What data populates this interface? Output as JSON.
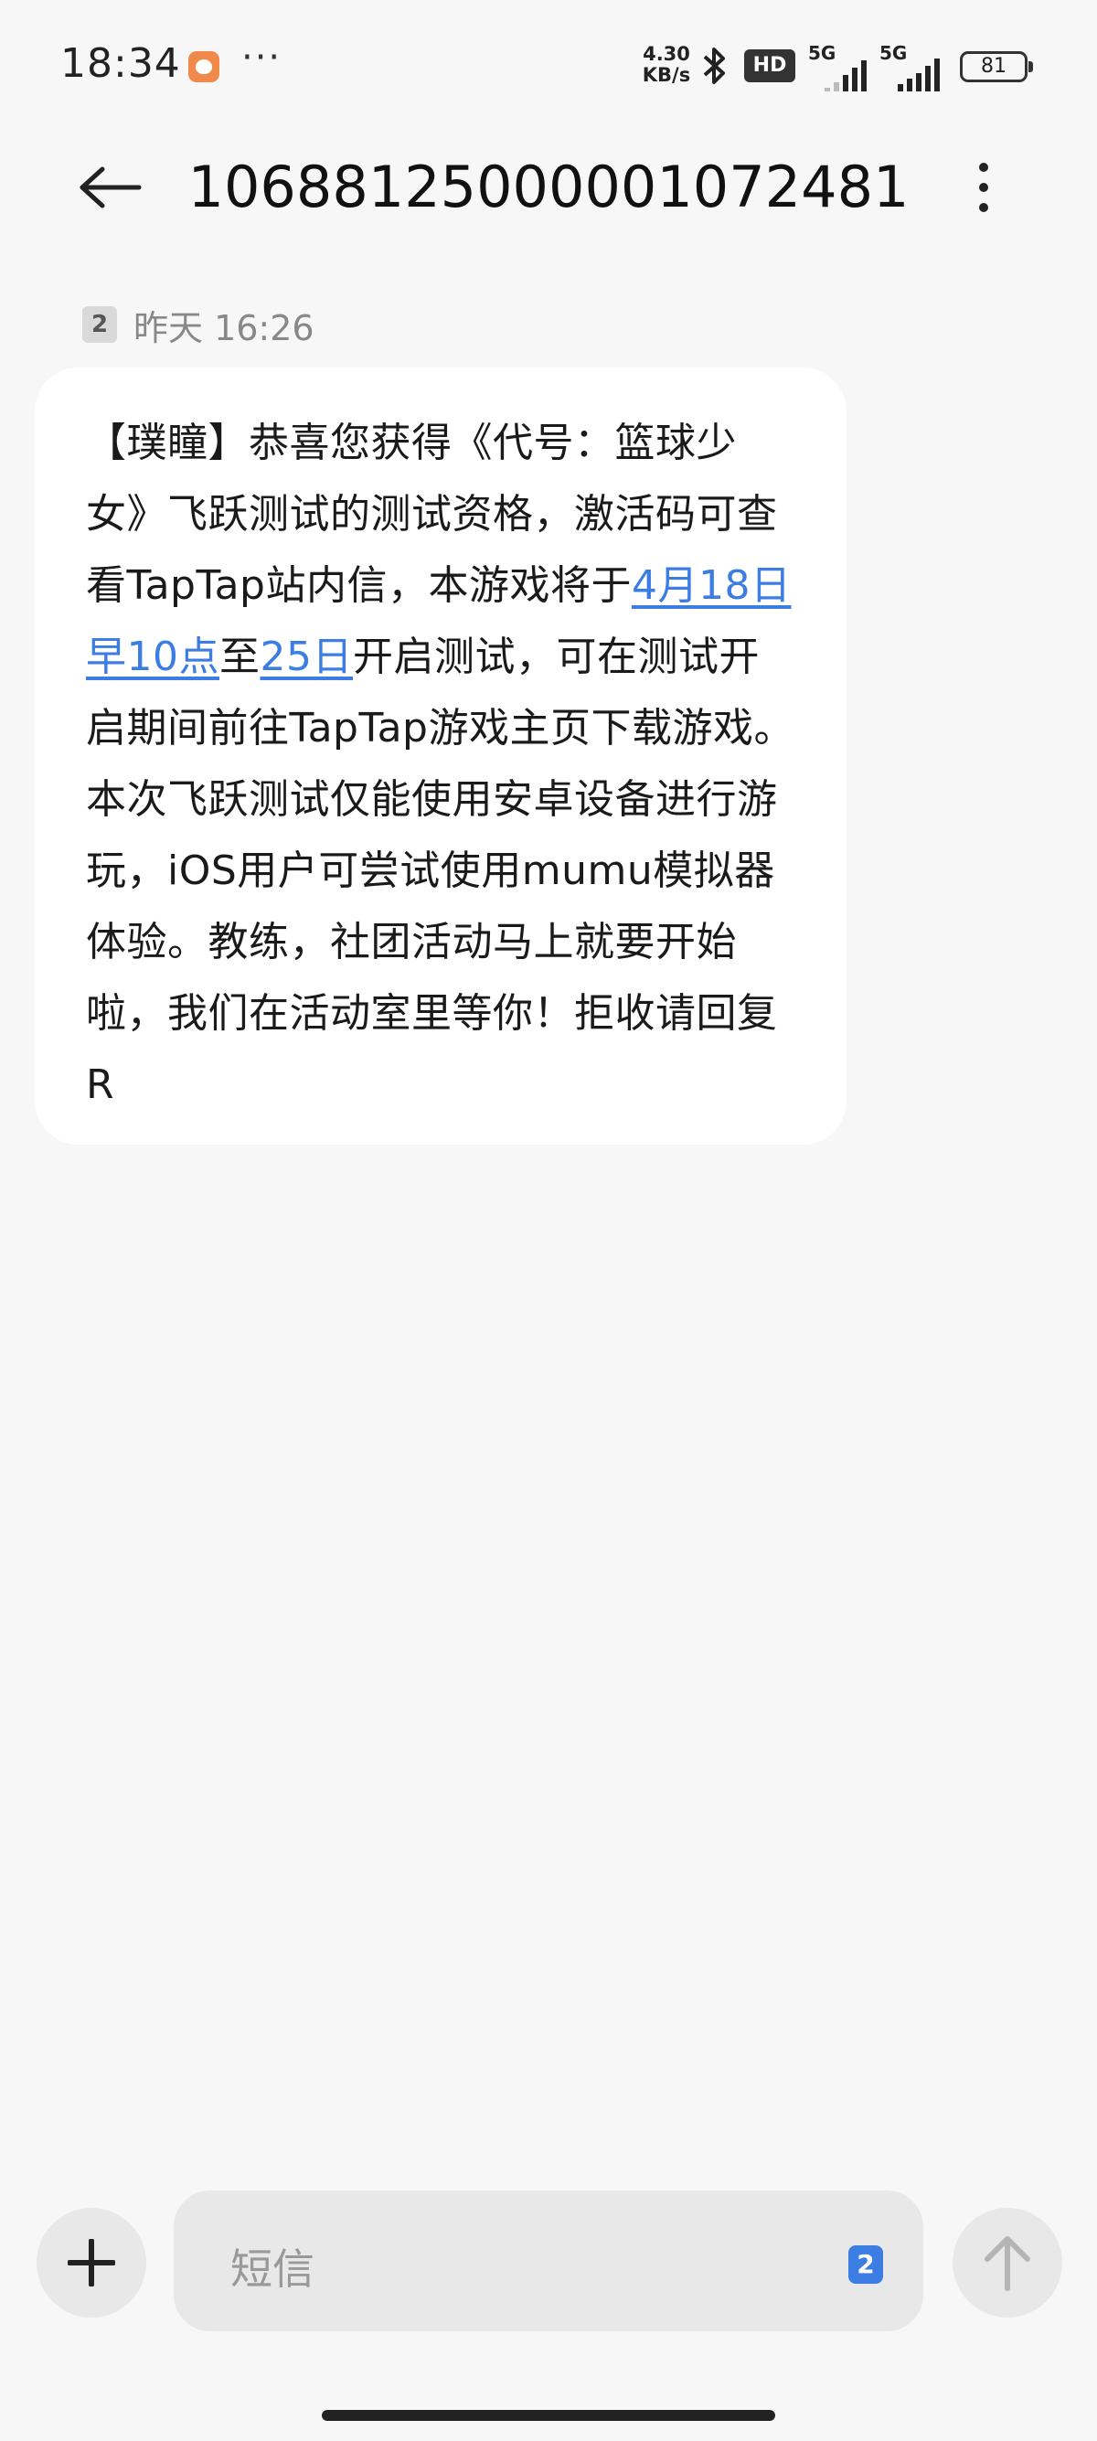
{
  "status_bar": {
    "time": "18:34",
    "more_dots": "···",
    "net_speed_value": "4.30",
    "net_speed_unit": "KB/s",
    "hd_label": "HD",
    "sim1_label": "5G",
    "sim2_label": "5G",
    "battery": "81"
  },
  "header": {
    "title": "1068812500000107248​1"
  },
  "message": {
    "sim_badge": "2",
    "timestamp": "昨天 16:26",
    "segments": [
      {
        "text": "【璞瞳】恭喜您获得《代号：篮球少女》飞跃测试的测试资格，激活码可查看TapTap站内信，本游戏将于",
        "link": false
      },
      {
        "text": "4月18日早10点",
        "link": true
      },
      {
        "text": "至",
        "link": false
      },
      {
        "text": "25日",
        "link": true
      },
      {
        "text": "开启测试，可在测试开启期间前往TapTap游戏主页下载游戏。本次飞跃测试仅能使用安卓设备进行游玩，iOS用户可尝试使用mumu模拟器体验。教练，社团活动马上就要开始啦，我们在活动室里等你！拒收请回复R",
        "link": false
      }
    ]
  },
  "composer": {
    "placeholder": "短信",
    "sim_selector": "2"
  },
  "colors": {
    "background": "#f7f7f7",
    "bubble": "#ffffff",
    "link": "#3b7de3",
    "control_bg": "#e8e8e8"
  }
}
